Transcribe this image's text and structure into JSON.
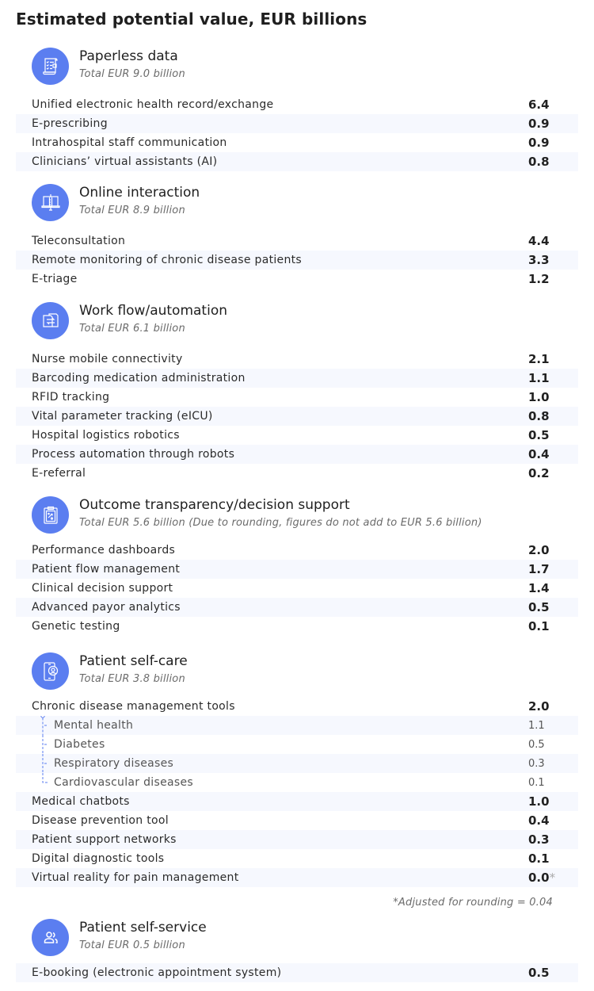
{
  "title": "Estimated potential value, EUR billions",
  "theme": {
    "accent": "#5b7ef0",
    "row_shade": "#f6f8fe",
    "tree_line": "#5b7ef0"
  },
  "sections": [
    {
      "icon": "document-checklist-icon",
      "title": "Paperless data",
      "subtitle": "Total EUR 9.0 billion",
      "rows": [
        {
          "label": "Unified electronic health record/exchange",
          "value": "6.4"
        },
        {
          "label": "E-prescribing",
          "value": "0.9"
        },
        {
          "label": "Intrahospital staff communication",
          "value": "0.9"
        },
        {
          "label": "Clinicians’ virtual assistants (AI)",
          "value": "0.8"
        }
      ]
    },
    {
      "icon": "laptop-syringe-icon",
      "title": "Online interaction",
      "subtitle": "Total EUR 8.9 billion",
      "rows": [
        {
          "label": "Teleconsultation",
          "value": "4.4"
        },
        {
          "label": "Remote monitoring of chronic disease patients",
          "value": "3.3"
        },
        {
          "label": "E-triage",
          "value": "1.2"
        }
      ]
    },
    {
      "icon": "document-swap-icon",
      "title": "Work flow/automation",
      "subtitle": "Total EUR 6.1 billion",
      "rows": [
        {
          "label": "Nurse mobile connectivity",
          "value": "2.1"
        },
        {
          "label": "Barcoding medication administration",
          "value": "1.1"
        },
        {
          "label": "RFID tracking",
          "value": "1.0"
        },
        {
          "label": "Vital parameter tracking (eICU)",
          "value": "0.8"
        },
        {
          "label": "Hospital logistics robotics",
          "value": "0.5"
        },
        {
          "label": "Process automation through robots",
          "value": "0.4"
        },
        {
          "label": "E-referral",
          "value": "0.2"
        }
      ]
    },
    {
      "icon": "clipboard-strategy-icon",
      "title": "Outcome transparency/decision support",
      "subtitle": "Total EUR 5.6 billion (Due to rounding, figures do not add to EUR 5.6 billion)",
      "rows": [
        {
          "label": "Performance dashboards",
          "value": "2.0"
        },
        {
          "label": "Patient flow management",
          "value": "1.7"
        },
        {
          "label": "Clinical decision support",
          "value": "1.4"
        },
        {
          "label": "Advanced payor analytics",
          "value": "0.5"
        },
        {
          "label": "Genetic testing",
          "value": "0.1"
        }
      ]
    },
    {
      "icon": "phone-patient-icon",
      "title": "Patient self-care",
      "subtitle": "Total EUR 3.8 billion",
      "rows": [
        {
          "label": "Chronic disease management tools",
          "value": "2.0",
          "children": [
            {
              "label": "Mental health",
              "value": "1.1"
            },
            {
              "label": "Diabetes",
              "value": "0.5"
            },
            {
              "label": "Respiratory diseases",
              "value": "0.3"
            },
            {
              "label": "Cardiovascular diseases",
              "value": "0.1"
            }
          ]
        },
        {
          "label": "Medical chatbots",
          "value": "1.0"
        },
        {
          "label": "Disease prevention tool",
          "value": "0.4"
        },
        {
          "label": "Patient support networks",
          "value": "0.3"
        },
        {
          "label": "Digital diagnostic tools",
          "value": "0.1"
        },
        {
          "label": "Virtual reality for pain management",
          "value": "0.0",
          "marker": "*"
        }
      ],
      "footnote": "*Adjusted for rounding = 0.04"
    },
    {
      "icon": "users-icon",
      "title": "Patient self-service",
      "subtitle": "Total EUR 0.5 billion",
      "rows": [
        {
          "label": "E-booking (electronic appointment system)",
          "value": "0.5"
        }
      ]
    }
  ]
}
